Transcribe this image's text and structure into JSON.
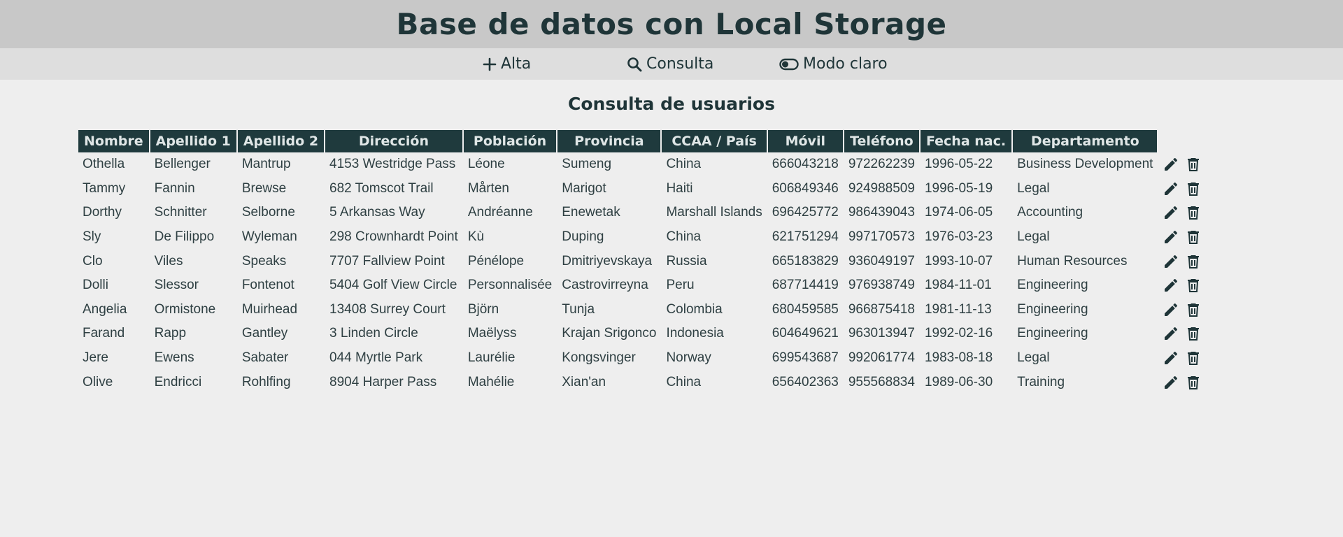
{
  "header": {
    "title": "Base de datos con Local Storage"
  },
  "nav": {
    "alta_label": "Alta",
    "consulta_label": "Consulta",
    "modo_label": "Modo claro",
    "icons": [
      "plus-icon",
      "search-icon",
      "toggle-icon"
    ]
  },
  "main": {
    "title": "Consulta de usuarios"
  },
  "table": {
    "columns": [
      "Nombre",
      "Apellido 1",
      "Apellido 2",
      "Dirección",
      "Población",
      "Provincia",
      "CCAA / País",
      "Móvil",
      "Teléfono",
      "Fecha nac.",
      "Departamento"
    ],
    "row_action_icons": [
      "edit-icon",
      "delete-icon"
    ],
    "rows": [
      [
        "Othella",
        "Bellenger",
        "Mantrup",
        "4153 Westridge Pass",
        "Léone",
        "Sumeng",
        "China",
        "666043218",
        "972262239",
        "1996-05-22",
        "Business Development"
      ],
      [
        "Tammy",
        "Fannin",
        "Brewse",
        "682 Tomscot Trail",
        "Mårten",
        "Marigot",
        "Haiti",
        "606849346",
        "924988509",
        "1996-05-19",
        "Legal"
      ],
      [
        "Dorthy",
        "Schnitter",
        "Selborne",
        "5 Arkansas Way",
        "Andréanne",
        "Enewetak",
        "Marshall Islands",
        "696425772",
        "986439043",
        "1974-06-05",
        "Accounting"
      ],
      [
        "Sly",
        "De Filippo",
        "Wyleman",
        "298 Crownhardt Point",
        "Kù",
        "Duping",
        "China",
        "621751294",
        "997170573",
        "1976-03-23",
        "Legal"
      ],
      [
        "Clo",
        "Viles",
        "Speaks",
        "7707 Fallview Point",
        "Pénélope",
        "Dmitriyevskaya",
        "Russia",
        "665183829",
        "936049197",
        "1993-10-07",
        "Human Resources"
      ],
      [
        "Dolli",
        "Slessor",
        "Fontenot",
        "5404 Golf View Circle",
        "Personnalisée",
        "Castrovirreyna",
        "Peru",
        "687714419",
        "976938749",
        "1984-11-01",
        "Engineering"
      ],
      [
        "Angelia",
        "Ormistone",
        "Muirhead",
        "13408 Surrey Court",
        "Björn",
        "Tunja",
        "Colombia",
        "680459585",
        "966875418",
        "1981-11-13",
        "Engineering"
      ],
      [
        "Farand",
        "Rapp",
        "Gantley",
        "3 Linden Circle",
        "Maëlyss",
        "Krajan Srigonco",
        "Indonesia",
        "604649621",
        "963013947",
        "1992-02-16",
        "Engineering"
      ],
      [
        "Jere",
        "Ewens",
        "Sabater",
        "044 Myrtle Park",
        "Laurélie",
        "Kongsvinger",
        "Norway",
        "699543687",
        "992061774",
        "1983-08-18",
        "Legal"
      ],
      [
        "Olive",
        "Endricci",
        "Rohlfing",
        "8904 Harper Pass",
        "Mahélie",
        "Xian'an",
        "China",
        "656402363",
        "955568834",
        "1989-06-30",
        "Training"
      ]
    ]
  }
}
